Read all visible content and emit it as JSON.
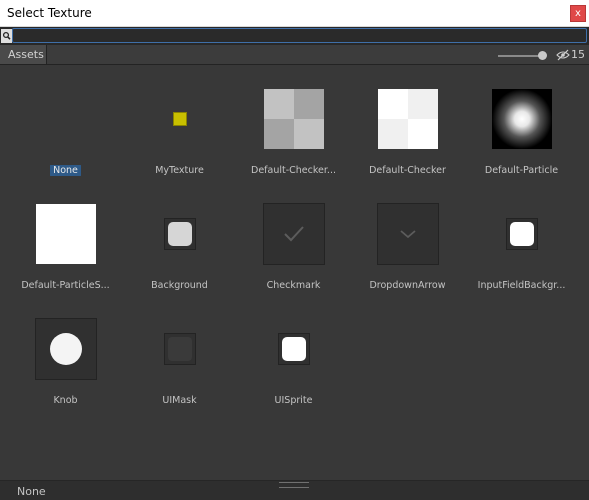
{
  "window": {
    "title": "Select Texture",
    "close_label": "x"
  },
  "search": {
    "value": "",
    "placeholder": ""
  },
  "toolbar": {
    "tab_label": "Assets",
    "visibility_count": "15",
    "zoom_slider_level": 0.9
  },
  "assets": [
    {
      "label": "None",
      "icon": "none",
      "selected": true
    },
    {
      "label": "MyTexture",
      "icon": "yellow-square-icon",
      "color": "#c8c000"
    },
    {
      "label": "Default-Checker...",
      "icon": "gray-checker-texture"
    },
    {
      "label": "Default-Checker",
      "icon": "white-checker-texture"
    },
    {
      "label": "Default-Particle",
      "icon": "radial-particle-texture"
    },
    {
      "label": "Default-ParticleS...",
      "icon": "white-square-texture"
    },
    {
      "label": "Background",
      "icon": "rounded-square-sprite"
    },
    {
      "label": "Checkmark",
      "icon": "checkmark-icon"
    },
    {
      "label": "DropdownArrow",
      "icon": "dropdown-arrow-icon"
    },
    {
      "label": "InputFieldBackgr...",
      "icon": "rounded-square-sprite-white"
    },
    {
      "label": "Knob",
      "icon": "circle-knob-texture"
    },
    {
      "label": "UIMask",
      "icon": "dark-mask-sprite"
    },
    {
      "label": "UISprite",
      "icon": "rounded-square-sprite-white"
    }
  ],
  "status": {
    "selection_text": "None"
  },
  "colors": {
    "background": "#383838",
    "selection": "#2e5a88",
    "close_button": "#e04848",
    "search_focus": "#3f6fa8"
  }
}
